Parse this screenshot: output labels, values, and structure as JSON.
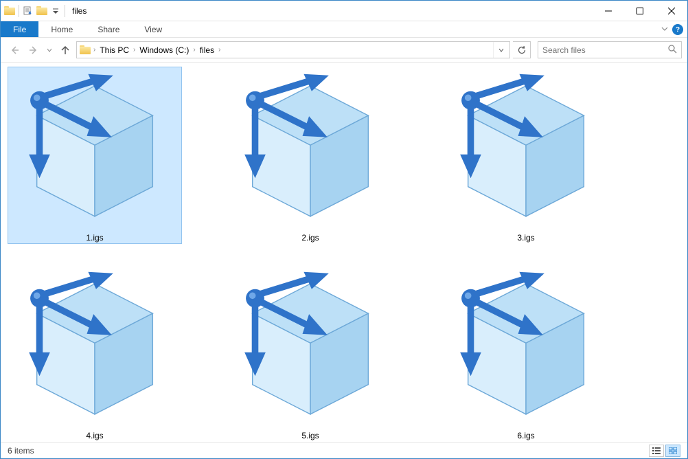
{
  "window": {
    "title": "files"
  },
  "ribbon": {
    "file": "File",
    "tabs": [
      "Home",
      "Share",
      "View"
    ]
  },
  "breadcrumb": {
    "parts": [
      "This PC",
      "Windows (C:)",
      "files"
    ]
  },
  "search": {
    "placeholder": "Search files"
  },
  "files": [
    {
      "name": "1.igs",
      "selected": true
    },
    {
      "name": "2.igs",
      "selected": false
    },
    {
      "name": "3.igs",
      "selected": false
    },
    {
      "name": "4.igs",
      "selected": false
    },
    {
      "name": "5.igs",
      "selected": false
    },
    {
      "name": "6.igs",
      "selected": false
    }
  ],
  "status": {
    "count_label": "6 items"
  }
}
